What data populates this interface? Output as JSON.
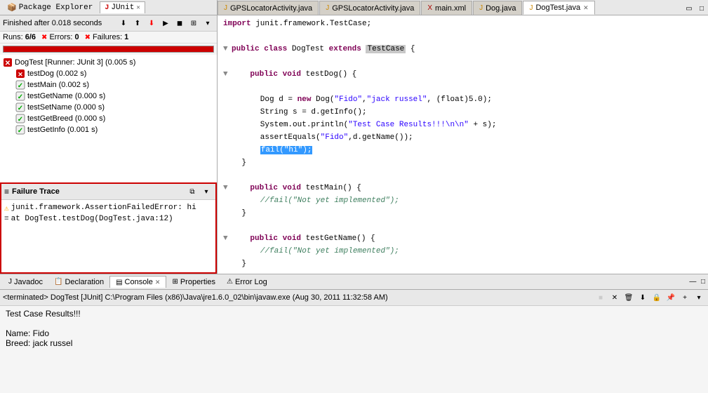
{
  "left_panel": {
    "tabs": [
      {
        "label": "Package Explorer",
        "icon": "📦",
        "active": false
      },
      {
        "label": "JUnit",
        "active": true,
        "close": true
      }
    ],
    "status": "Finished after 0.018 seconds",
    "runs": "6/6",
    "errors_label": "Errors:",
    "errors_value": "0",
    "failures_label": "Failures:",
    "failures_value": "1",
    "tree": {
      "root": {
        "label": "DogTest [Runner: JUnit 3] (0.005 s)",
        "icon": "fail"
      },
      "children": [
        {
          "label": "testDog (0.002 s)",
          "icon": "fail"
        },
        {
          "label": "testMain (0.002 s)",
          "icon": "pass"
        },
        {
          "label": "testGetName (0.000 s)",
          "icon": "pass"
        },
        {
          "label": "testSetName (0.000 s)",
          "icon": "pass"
        },
        {
          "label": "testGetBreed (0.000 s)",
          "icon": "pass"
        },
        {
          "label": "testGetInfo (0.001 s)",
          "icon": "pass"
        }
      ]
    },
    "failure_trace": {
      "title": "Failure Trace",
      "lines": [
        "junit.framework.AssertionFailedError: hi",
        "at DogTest.testDog(DogTest.java:12)"
      ]
    }
  },
  "editor": {
    "tabs": [
      {
        "label": "GPSLocatorActivity.java",
        "active": false
      },
      {
        "label": "GPSLocatorActivity.java",
        "active": false
      },
      {
        "label": "main.xml",
        "active": false
      },
      {
        "label": "Dog.java",
        "active": false
      },
      {
        "label": "DogTest.java",
        "active": true,
        "close": true
      }
    ],
    "code": [
      {
        "text": "import junit.framework.TestCase;",
        "indent": 0
      },
      {
        "text": "",
        "indent": 0
      },
      {
        "text": "public class DogTest extends TestCase {",
        "indent": 0
      },
      {
        "text": "",
        "indent": 0
      },
      {
        "text": "    public void testDog() {",
        "indent": 0,
        "collapse": true
      },
      {
        "text": "",
        "indent": 0
      },
      {
        "text": "        Dog d = new Dog(\"Fido\",\"jack russel\", (float)5.0);",
        "indent": 0
      },
      {
        "text": "        String s = d.getInfo();",
        "indent": 0
      },
      {
        "text": "        System.out.println(\"Test Case Results!!!\\n\\n\" + s);",
        "indent": 0
      },
      {
        "text": "        assertEquals(\"Fido\",d.getName());",
        "indent": 0
      },
      {
        "text": "        fail(\"hi\");",
        "indent": 0,
        "highlight": true
      },
      {
        "text": "    }",
        "indent": 0
      },
      {
        "text": "",
        "indent": 0
      },
      {
        "text": "    public void testMain() {",
        "indent": 0,
        "collapse": true
      },
      {
        "text": "        //fail(\"Not yet implemented\");",
        "indent": 0
      },
      {
        "text": "    }",
        "indent": 0
      },
      {
        "text": "",
        "indent": 0
      },
      {
        "text": "    public void testGetName() {",
        "indent": 0,
        "collapse": true
      },
      {
        "text": "        //fail(\"Not yet implemented\");",
        "indent": 0
      },
      {
        "text": "    }",
        "indent": 0
      }
    ]
  },
  "bottom": {
    "tabs": [
      {
        "label": "Javadoc",
        "active": false
      },
      {
        "label": "Declaration",
        "active": false
      },
      {
        "label": "Console",
        "active": true,
        "close": true
      },
      {
        "label": "Properties",
        "active": false
      },
      {
        "label": "Error Log",
        "active": false
      }
    ],
    "console": {
      "header": "<terminated> DogTest [JUnit] C:\\Program Files (x86)\\Java\\jre1.6.0_02\\bin\\javaw.exe (Aug 30, 2011 11:32:58 AM)",
      "output": "Test Case Results!!!\n\nName: Fido\nBreed: jack russel"
    }
  }
}
